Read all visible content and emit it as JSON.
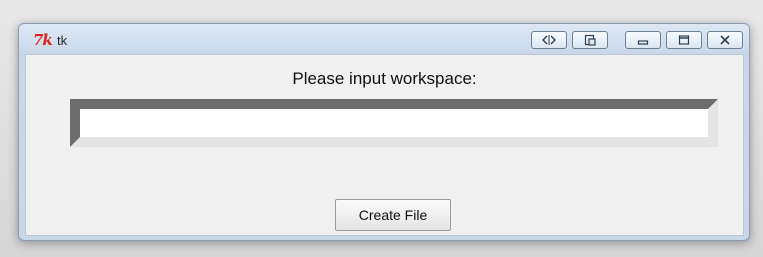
{
  "window": {
    "title": "tk",
    "icon": "tk-feather-icon"
  },
  "titlebar_buttons": [
    {
      "name": "panel-toggle-icon"
    },
    {
      "name": "restore-window-icon"
    },
    {
      "name": "minimize-icon"
    },
    {
      "name": "maximize-icon"
    },
    {
      "name": "close-icon"
    }
  ],
  "form": {
    "prompt": "Please input workspace:",
    "input_value": "",
    "create_button_label": "Create File"
  }
}
